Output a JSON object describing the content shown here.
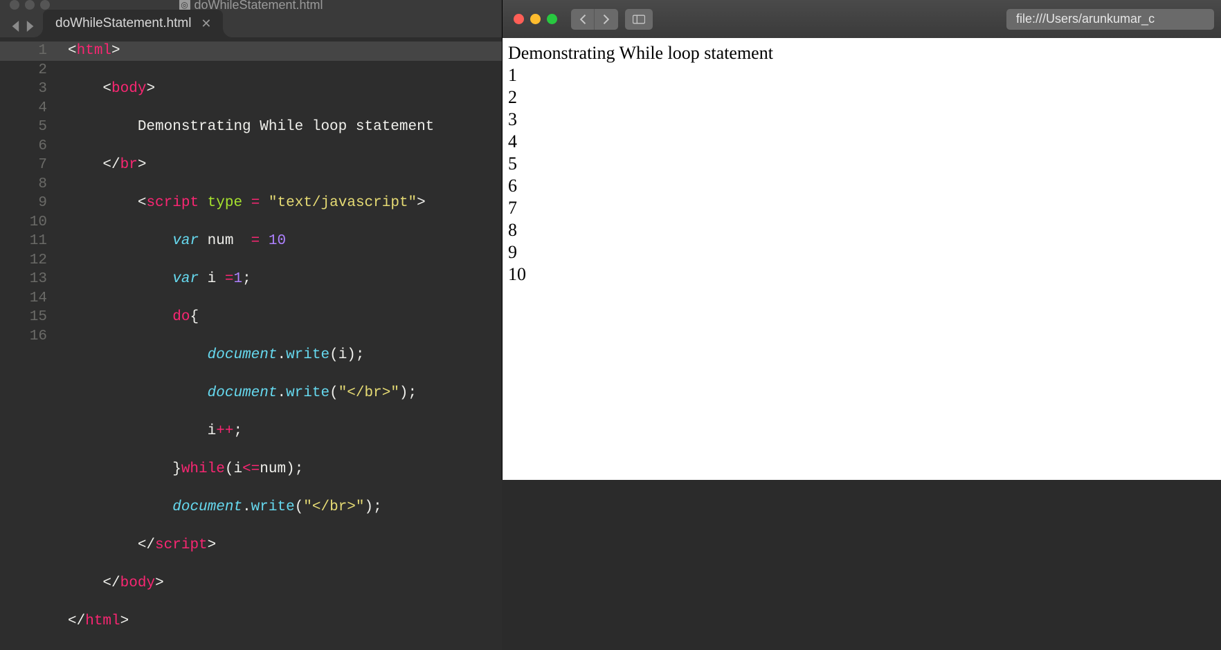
{
  "editor": {
    "window_title": "doWhileStatement.html",
    "tab_label": "doWhileStatement.html",
    "line_numbers": [
      "1",
      "2",
      "3",
      "4",
      "5",
      "6",
      "7",
      "8",
      "9",
      "10",
      "11",
      "12",
      "13",
      "14",
      "15",
      "16"
    ],
    "current_line": 1,
    "code_lines": [
      [
        {
          "t": "<",
          "c": "c-br"
        },
        {
          "t": "html",
          "c": "c-tag"
        },
        {
          "t": ">",
          "c": "c-br"
        }
      ],
      [
        {
          "t": "    ",
          "c": "c-plain"
        },
        {
          "t": "<",
          "c": "c-br"
        },
        {
          "t": "body",
          "c": "c-tag"
        },
        {
          "t": ">",
          "c": "c-br"
        }
      ],
      [
        {
          "t": "        Demonstrating While loop statement",
          "c": "c-plain"
        }
      ],
      [
        {
          "t": "    ",
          "c": "c-plain"
        },
        {
          "t": "</",
          "c": "c-br"
        },
        {
          "t": "br",
          "c": "c-tag"
        },
        {
          "t": ">",
          "c": "c-br"
        }
      ],
      [
        {
          "t": "        ",
          "c": "c-plain"
        },
        {
          "t": "<",
          "c": "c-br"
        },
        {
          "t": "script",
          "c": "c-tag"
        },
        {
          "t": " ",
          "c": "c-plain"
        },
        {
          "t": "type",
          "c": "c-attr"
        },
        {
          "t": " ",
          "c": "c-plain"
        },
        {
          "t": "=",
          "c": "c-op"
        },
        {
          "t": " ",
          "c": "c-plain"
        },
        {
          "t": "\"text/javascript\"",
          "c": "c-str"
        },
        {
          "t": ">",
          "c": "c-br"
        }
      ],
      [
        {
          "t": "            ",
          "c": "c-plain"
        },
        {
          "t": "var",
          "c": "c-kw"
        },
        {
          "t": " num  ",
          "c": "c-var"
        },
        {
          "t": "=",
          "c": "c-op"
        },
        {
          "t": " ",
          "c": "c-plain"
        },
        {
          "t": "10",
          "c": "c-num"
        }
      ],
      [
        {
          "t": "            ",
          "c": "c-plain"
        },
        {
          "t": "var",
          "c": "c-kw"
        },
        {
          "t": " i ",
          "c": "c-var"
        },
        {
          "t": "=",
          "c": "c-op"
        },
        {
          "t": "1",
          "c": "c-num"
        },
        {
          "t": ";",
          "c": "c-plain"
        }
      ],
      [
        {
          "t": "            ",
          "c": "c-plain"
        },
        {
          "t": "do",
          "c": "c-op"
        },
        {
          "t": "{",
          "c": "c-plain"
        }
      ],
      [
        {
          "t": "                ",
          "c": "c-plain"
        },
        {
          "t": "document",
          "c": "c-obj"
        },
        {
          "t": ".",
          "c": "c-plain"
        },
        {
          "t": "write",
          "c": "c-fn"
        },
        {
          "t": "(i);",
          "c": "c-plain"
        }
      ],
      [
        {
          "t": "                ",
          "c": "c-plain"
        },
        {
          "t": "document",
          "c": "c-obj"
        },
        {
          "t": ".",
          "c": "c-plain"
        },
        {
          "t": "write",
          "c": "c-fn"
        },
        {
          "t": "(",
          "c": "c-plain"
        },
        {
          "t": "\"</br>\"",
          "c": "c-str"
        },
        {
          "t": ");",
          "c": "c-plain"
        }
      ],
      [
        {
          "t": "                i",
          "c": "c-plain"
        },
        {
          "t": "++",
          "c": "c-op"
        },
        {
          "t": ";",
          "c": "c-plain"
        }
      ],
      [
        {
          "t": "            }",
          "c": "c-plain"
        },
        {
          "t": "while",
          "c": "c-op"
        },
        {
          "t": "(i",
          "c": "c-plain"
        },
        {
          "t": "<=",
          "c": "c-op"
        },
        {
          "t": "num);",
          "c": "c-plain"
        }
      ],
      [
        {
          "t": "            ",
          "c": "c-plain"
        },
        {
          "t": "document",
          "c": "c-obj"
        },
        {
          "t": ".",
          "c": "c-plain"
        },
        {
          "t": "write",
          "c": "c-fn"
        },
        {
          "t": "(",
          "c": "c-plain"
        },
        {
          "t": "\"</br>\"",
          "c": "c-str"
        },
        {
          "t": ");",
          "c": "c-plain"
        }
      ],
      [
        {
          "t": "        ",
          "c": "c-plain"
        },
        {
          "t": "</",
          "c": "c-br"
        },
        {
          "t": "script",
          "c": "c-tag"
        },
        {
          "t": ">",
          "c": "c-br"
        }
      ],
      [
        {
          "t": "    ",
          "c": "c-plain"
        },
        {
          "t": "</",
          "c": "c-br"
        },
        {
          "t": "body",
          "c": "c-tag"
        },
        {
          "t": ">",
          "c": "c-br"
        }
      ],
      [
        {
          "t": "</",
          "c": "c-br"
        },
        {
          "t": "html",
          "c": "c-tag"
        },
        {
          "t": ">",
          "c": "c-br"
        }
      ]
    ]
  },
  "browser": {
    "url": "file:///Users/arunkumar_c",
    "page": {
      "heading": "Demonstrating While loop statement",
      "numbers": [
        "1",
        "2",
        "3",
        "4",
        "5",
        "6",
        "7",
        "8",
        "9",
        "10"
      ]
    }
  }
}
